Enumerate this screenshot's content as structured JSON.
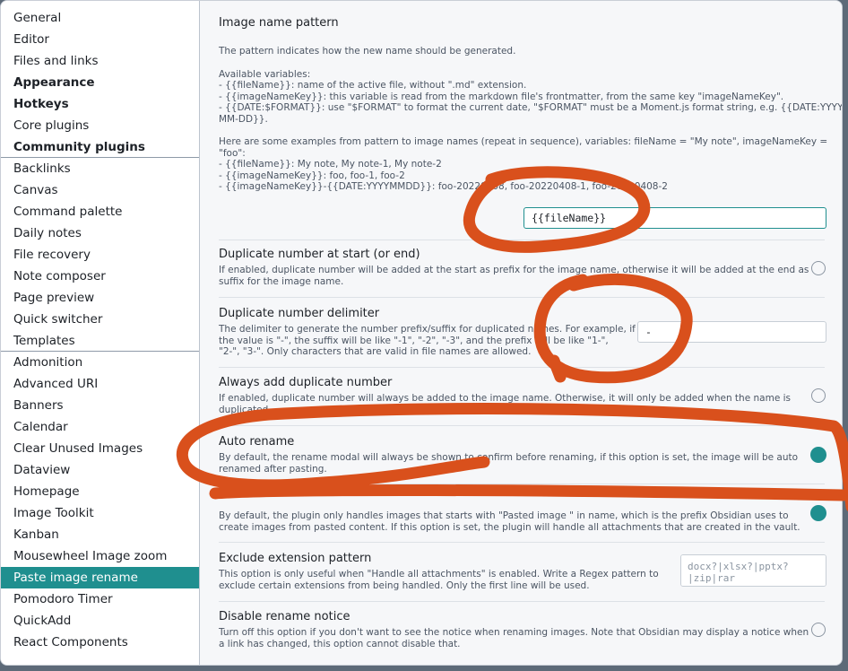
{
  "sidebar": {
    "items": [
      {
        "label": "General",
        "bold": false,
        "active": false
      },
      {
        "label": "Editor",
        "bold": false,
        "active": false
      },
      {
        "label": "Files and links",
        "bold": false,
        "active": false
      },
      {
        "label": "Appearance",
        "bold": true,
        "active": false
      },
      {
        "label": "Hotkeys",
        "bold": true,
        "active": false
      },
      {
        "label": "Core plugins",
        "bold": false,
        "active": false
      },
      {
        "label": "Community plugins",
        "bold": true,
        "active": false
      },
      {
        "label": "Backlinks",
        "bold": false,
        "active": false
      },
      {
        "label": "Canvas",
        "bold": false,
        "active": false
      },
      {
        "label": "Command palette",
        "bold": false,
        "active": false
      },
      {
        "label": "Daily notes",
        "bold": false,
        "active": false
      },
      {
        "label": "File recovery",
        "bold": false,
        "active": false
      },
      {
        "label": "Note composer",
        "bold": false,
        "active": false
      },
      {
        "label": "Page preview",
        "bold": false,
        "active": false
      },
      {
        "label": "Quick switcher",
        "bold": false,
        "active": false
      },
      {
        "label": "Templates",
        "bold": false,
        "active": false
      },
      {
        "label": "Admonition",
        "bold": false,
        "active": false
      },
      {
        "label": "Advanced URI",
        "bold": false,
        "active": false
      },
      {
        "label": "Banners",
        "bold": false,
        "active": false
      },
      {
        "label": "Calendar",
        "bold": false,
        "active": false
      },
      {
        "label": "Clear Unused Images",
        "bold": false,
        "active": false
      },
      {
        "label": "Dataview",
        "bold": false,
        "active": false
      },
      {
        "label": "Homepage",
        "bold": false,
        "active": false
      },
      {
        "label": "Image Toolkit",
        "bold": false,
        "active": false
      },
      {
        "label": "Kanban",
        "bold": false,
        "active": false
      },
      {
        "label": "Mousewheel Image zoom",
        "bold": false,
        "active": false
      },
      {
        "label": "Paste image rename",
        "bold": false,
        "active": true
      },
      {
        "label": "Pomodoro Timer",
        "bold": false,
        "active": false
      },
      {
        "label": "QuickAdd",
        "bold": false,
        "active": false
      },
      {
        "label": "React Components",
        "bold": false,
        "active": false
      }
    ]
  },
  "settings": {
    "image_name_pattern": {
      "title": "Image name pattern",
      "desc_intro": "The pattern indicates how the new name should be generated.",
      "desc_vars_header": "Available variables:",
      "desc_vars": [
        "- {{fileName}}: name of the active file, without \".md\" extension.",
        "- {{imageNameKey}}: this variable is read from the markdown file's frontmatter, from the same key \"imageNameKey\".",
        "- {{DATE:$FORMAT}}: use \"$FORMAT\" to format the current date, \"$FORMAT\" must be a Moment.js format string, e.g. {{DATE:YYYY-",
        "MM-DD}}."
      ],
      "desc_examples": [
        "Here are some examples from pattern to image names (repeat in sequence), variables: fileName = \"My note\", imageNameKey =",
        "\"foo\":",
        "- {{fileName}}: My note, My note-1, My note-2",
        "- {{imageNameKey}}: foo, foo-1, foo-2",
        "- {{imageNameKey}}-{{DATE:YYYYMMDD}}: foo-20220408, foo-20220408-1, foo-20220408-2"
      ],
      "value": "{{fileName}}"
    },
    "duplicate_at_start": {
      "title": "Duplicate number at start (or end)",
      "desc": [
        "If enabled, duplicate number will be added at the start as prefix for the image name, otherwise it will be added at the end as",
        "suffix for the image name."
      ],
      "enabled": false
    },
    "duplicate_delimiter": {
      "title": "Duplicate number delimiter",
      "desc": [
        "The delimiter to generate the number prefix/suffix for duplicated names. For example, if",
        "the value is \"-\", the suffix will be like \"-1\", \"-2\", \"-3\", and the prefix will be like \"1-\",",
        "\"2-\", \"3-\". Only characters that are valid in file names are allowed."
      ],
      "value": "-"
    },
    "always_add_duplicate": {
      "title": "Always add duplicate number",
      "desc": [
        "If enabled, duplicate number will always be added to the image name. Otherwise, it will only be added when the name is",
        "duplicated."
      ],
      "enabled": false
    },
    "auto_rename": {
      "title": "Auto rename",
      "desc": [
        "By default, the rename modal will always be shown to confirm before renaming, if this option is set, the image will be auto",
        "renamed after pasting."
      ],
      "enabled": true
    },
    "handle_all_attachments": {
      "desc": [
        "By default, the plugin only handles images that starts with \"Pasted image \" in name, which is the prefix Obsidian uses to",
        "create images from pasted content. If this option is set, the plugin will handle all attachments that are created in the vault."
      ],
      "enabled": true
    },
    "exclude_extension": {
      "title": "Exclude extension pattern",
      "desc": [
        "This option is only useful when \"Handle all attachments\" is enabled. Write a Regex pattern to",
        "exclude certain extensions from being handled. Only the first line will be used."
      ],
      "placeholder": "docx?|xlsx?|pptx?|zip|rar"
    },
    "disable_rename_notice": {
      "title": "Disable rename notice",
      "desc": [
        "Turn off this option if you don't want to see the notice when renaming images. Note that Obsidian may display a notice when",
        "a link has changed, this option cannot disable that."
      ],
      "enabled": false
    }
  },
  "colors": {
    "accent": "#1f8f8f",
    "annotation": "#d9501c"
  }
}
